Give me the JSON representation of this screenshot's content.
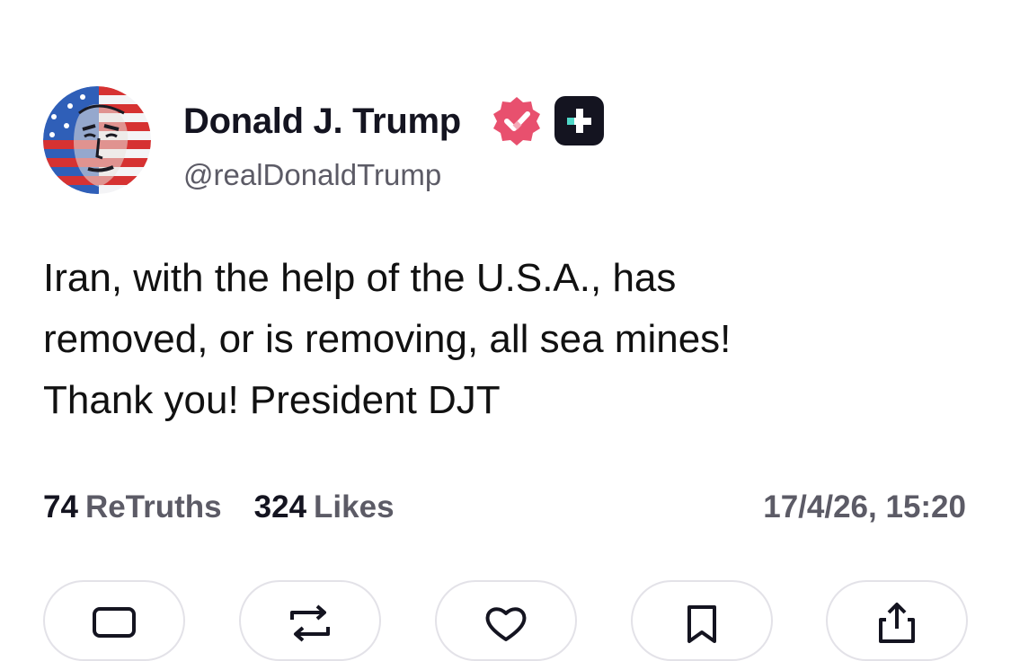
{
  "author": {
    "display_name": "Donald J. Trump",
    "handle": "@realDonaldTrump",
    "avatar_icon": "flag-portrait-avatar",
    "verified_icon": "verified-badge-icon",
    "verified_color": "#e8506e",
    "plus_icon": "plus-badge-icon",
    "plus_accent": "#4fd8c8"
  },
  "post": {
    "lines": [
      "Iran, with the help of the U.S.A., has",
      "removed, or is removing, all sea mines!",
      "Thank you! President DJT"
    ]
  },
  "stats": {
    "retruths_count": "74",
    "retruths_label": "ReTruths",
    "likes_count": "324",
    "likes_label": "Likes",
    "timestamp": "17/4/26, 15:20"
  },
  "actions": [
    {
      "icon": "reply-icon"
    },
    {
      "icon": "retruth-icon"
    },
    {
      "icon": "like-icon"
    },
    {
      "icon": "bookmark-icon"
    },
    {
      "icon": "share-icon"
    }
  ]
}
